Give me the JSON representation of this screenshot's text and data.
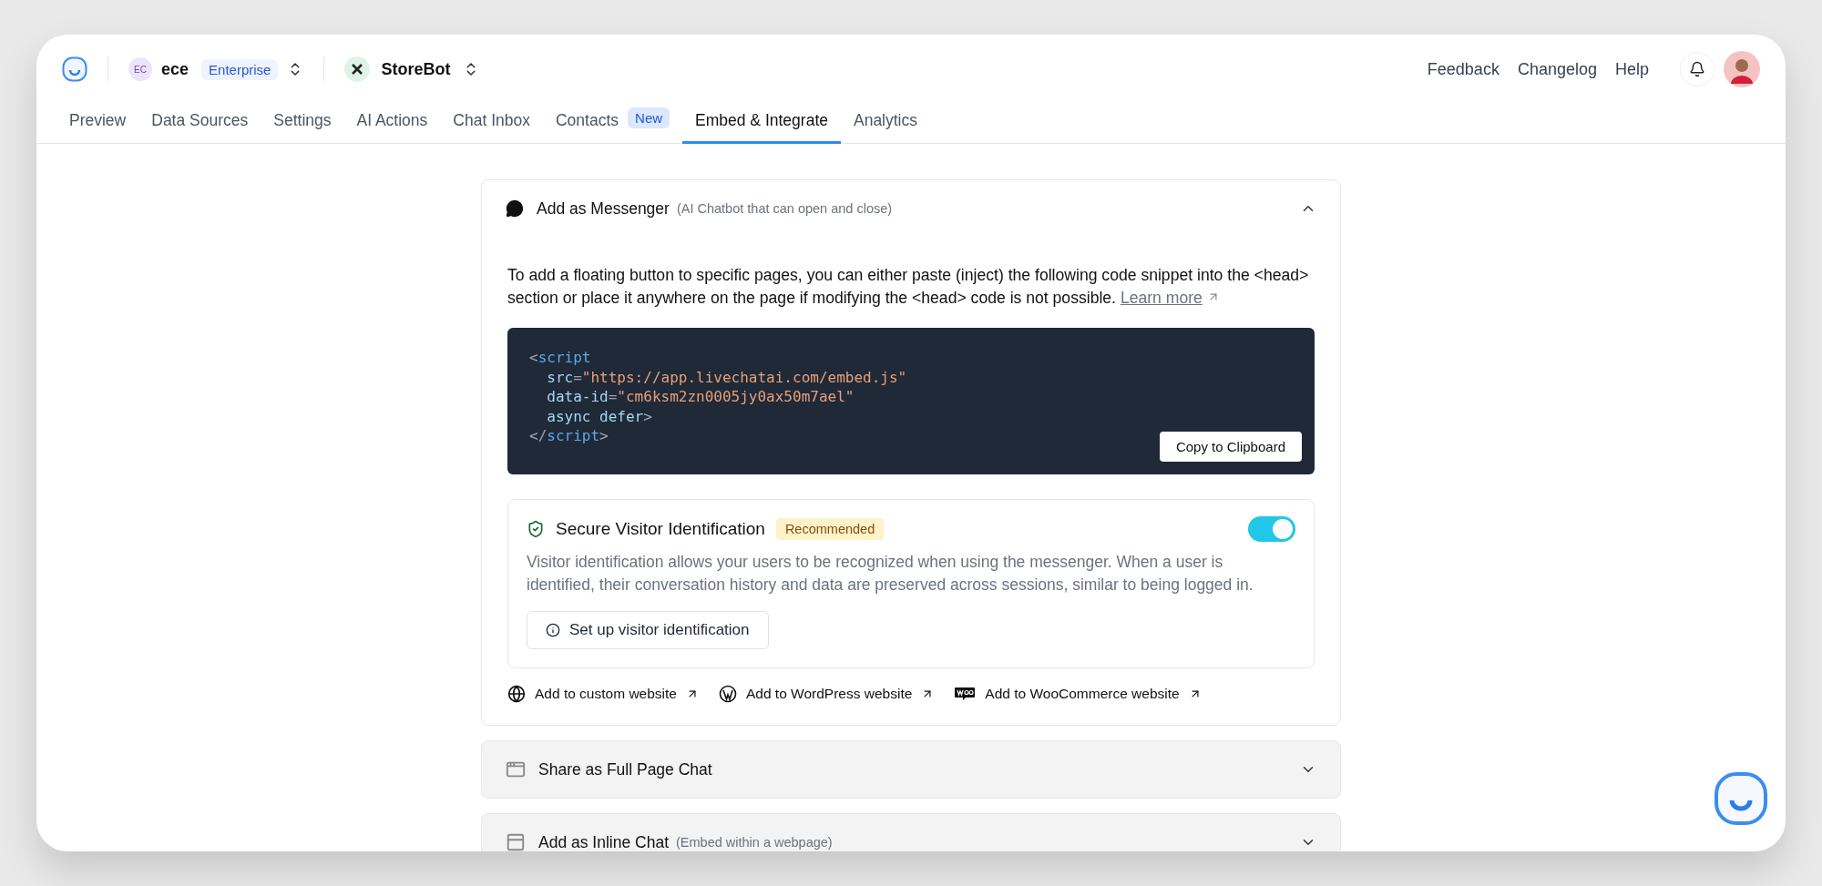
{
  "topbar": {
    "workspace": {
      "initials": "EC",
      "name": "ece",
      "plan": "Enterprise"
    },
    "bot": {
      "name": "StoreBot"
    },
    "links": [
      "Feedback",
      "Changelog",
      "Help"
    ]
  },
  "tabs": [
    {
      "label": "Preview",
      "selected": false
    },
    {
      "label": "Data Sources",
      "selected": false
    },
    {
      "label": "Settings",
      "selected": false
    },
    {
      "label": "AI Actions",
      "selected": false
    },
    {
      "label": "Chat Inbox",
      "selected": false
    },
    {
      "label": "Contacts",
      "selected": false,
      "badge": "New"
    },
    {
      "label": "Embed & Integrate",
      "selected": true
    },
    {
      "label": "Analytics",
      "selected": false
    }
  ],
  "sections": [
    {
      "kind": "messenger",
      "title": "Add as Messenger",
      "subtitle": "(AI Chatbot that can open and close)",
      "expanded": true,
      "intro": "To add a floating button to specific pages, you can either paste (inject) the following code snippet into the <head> section or place it anywhere on the page if modifying the <head> code is not possible.",
      "learn_more": "Learn more",
      "code": [
        [
          {
            "kind": "punct",
            "text": "<"
          },
          {
            "kind": "tag",
            "text": "script"
          }
        ],
        [
          {
            "kind": "attr",
            "text": "  src"
          },
          {
            "kind": "punct",
            "text": "="
          },
          {
            "kind": "string",
            "text": "\"https://app.livechatai.com/embed.js\""
          }
        ],
        [
          {
            "kind": "attr",
            "text": "  data-id"
          },
          {
            "kind": "punct",
            "text": "="
          },
          {
            "kind": "string",
            "text": "\"cm6ksm2zn0005jy0ax50m7ael\""
          }
        ],
        [
          {
            "kind": "attr",
            "text": "  async defer"
          },
          {
            "kind": "punct",
            "text": ">"
          }
        ],
        [
          {
            "kind": "punct",
            "text": "</"
          },
          {
            "kind": "tag",
            "text": "script"
          },
          {
            "kind": "punct",
            "text": ">"
          }
        ]
      ],
      "copy_button": "Copy to Clipboard",
      "secure": {
        "title": "Secure Visitor Identification",
        "badge": "Recommended",
        "on": true,
        "description": "Visitor identification allows your users to be recognized when using the messenger. When a user is identified, their conversation history and data are preserved across sessions, similar to being logged in.",
        "button": "Set up visitor identification"
      },
      "integrations": [
        {
          "kind": "custom",
          "label": "Add to custom website"
        },
        {
          "kind": "wordpress",
          "label": "Add to WordPress website"
        },
        {
          "kind": "woocommerce",
          "label": "Add to WooCommerce website"
        }
      ]
    },
    {
      "kind": "fullpage",
      "title": "Share as Full Page Chat",
      "expanded": false
    },
    {
      "kind": "inline",
      "title": "Add as Inline Chat",
      "subtitle": "(Embed within a webpage)",
      "expanded": false
    }
  ]
}
